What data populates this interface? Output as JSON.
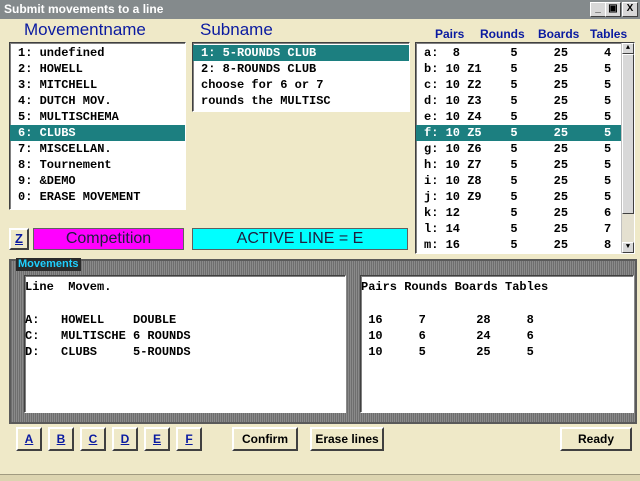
{
  "window": {
    "title": "Submit movements to a line",
    "min_label": "_",
    "max_label": "▣",
    "close_label": "X"
  },
  "headers": {
    "movementname": "Movementname",
    "subname": "Subname",
    "pairs": "Pairs",
    "rounds": "Rounds",
    "boards": "Boards",
    "tables": "Tables"
  },
  "movement_list": [
    {
      "label": "1: undefined",
      "selected": false
    },
    {
      "label": "2: HOWELL",
      "selected": false
    },
    {
      "label": "3: MITCHELL",
      "selected": false
    },
    {
      "label": "4: DUTCH MOV.",
      "selected": false
    },
    {
      "label": "5: MULTISCHEMA",
      "selected": false
    },
    {
      "label": "6: CLUBS",
      "selected": true
    },
    {
      "label": "7: MISCELLAN.",
      "selected": false
    },
    {
      "label": "8: Tournement",
      "selected": false
    },
    {
      "label": "9: &DEMO",
      "selected": false
    },
    {
      "label": "0: ERASE MOVEMENT",
      "selected": false
    }
  ],
  "subname_list": [
    {
      "label": "1: 5-ROUNDS CLUB",
      "selected": true
    },
    {
      "label": "2: 8-ROUNDS CLUB",
      "selected": false
    },
    {
      "label": "choose for 6 or 7",
      "selected": false
    },
    {
      "label": "rounds the MULTISC",
      "selected": false
    }
  ],
  "lines_list": [
    {
      "label": "a:  8       5     25     4",
      "selected": false
    },
    {
      "label": "b: 10 Z1    5     25     5",
      "selected": false
    },
    {
      "label": "c: 10 Z2    5     25     5",
      "selected": false
    },
    {
      "label": "d: 10 Z3    5     25     5",
      "selected": false
    },
    {
      "label": "e: 10 Z4    5     25     5",
      "selected": false
    },
    {
      "label": "f: 10 Z5    5     25     5",
      "selected": true
    },
    {
      "label": "g: 10 Z6    5     25     5",
      "selected": false
    },
    {
      "label": "h: 10 Z7    5     25     5",
      "selected": false
    },
    {
      "label": "i: 10 Z8    5     25     5",
      "selected": false
    },
    {
      "label": "j: 10 Z9    5     25     5",
      "selected": false
    },
    {
      "label": "k: 12       5     25     6",
      "selected": false
    },
    {
      "label": "l: 14       5     25     7",
      "selected": false
    },
    {
      "label": "m: 16       5     25     8",
      "selected": false
    }
  ],
  "z_button": "Z",
  "competition_label": "Competition",
  "active_line_label": "ACTIVE LINE = E",
  "movements_group_label": "Movements",
  "movements_left": {
    "header": "Line  Movem.",
    "rows": [
      "A:   HOWELL    DOUBLE",
      "C:   MULTISCHE 6 ROUNDS",
      "D:   CLUBS     5-ROUNDS"
    ]
  },
  "movements_right": {
    "header": "Pairs Rounds Boards Tables",
    "rows": [
      " 16     7       28     8",
      " 10     6       24     6",
      " 10     5       25     5"
    ]
  },
  "line_buttons": [
    "A",
    "B",
    "C",
    "D",
    "E",
    "F"
  ],
  "confirm_label": "Confirm",
  "erase_lines_label": "Erase lines",
  "ready_label": "Ready",
  "colors": {
    "selection": "#1c7f80",
    "competition_bg": "#ff00ff",
    "active_line_bg": "#00ffff",
    "header_text": "#0a1aa0",
    "background": "#efe9c8"
  }
}
